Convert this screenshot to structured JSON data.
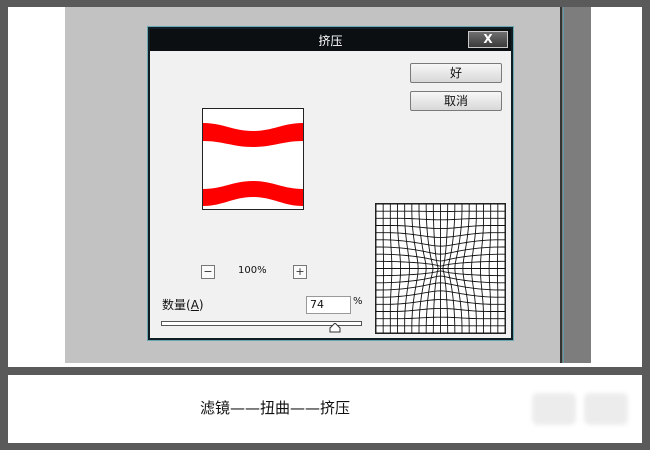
{
  "dialog": {
    "title": "挤压",
    "close_glyph": "X",
    "ok_label": "好",
    "cancel_label": "取消",
    "zoom_out_glyph": "−",
    "zoom_in_glyph": "+",
    "zoom_level": "100%",
    "amount_label": "数量",
    "amount_shortcut": "A",
    "amount_value": "74",
    "amount_unit": "%",
    "slider_fraction": 0.87
  },
  "caption": "滤镜——扭曲——挤压",
  "colors": {
    "titlebar": "#0b0f12",
    "preview_band": "#ff0000",
    "workspace": "#c2c2c2",
    "frame": "#5a5a5a"
  },
  "icons": {
    "close": "close-icon",
    "zoom_out": "minus-icon",
    "zoom_in": "plus-icon",
    "slider_thumb": "triangle-up-icon"
  }
}
